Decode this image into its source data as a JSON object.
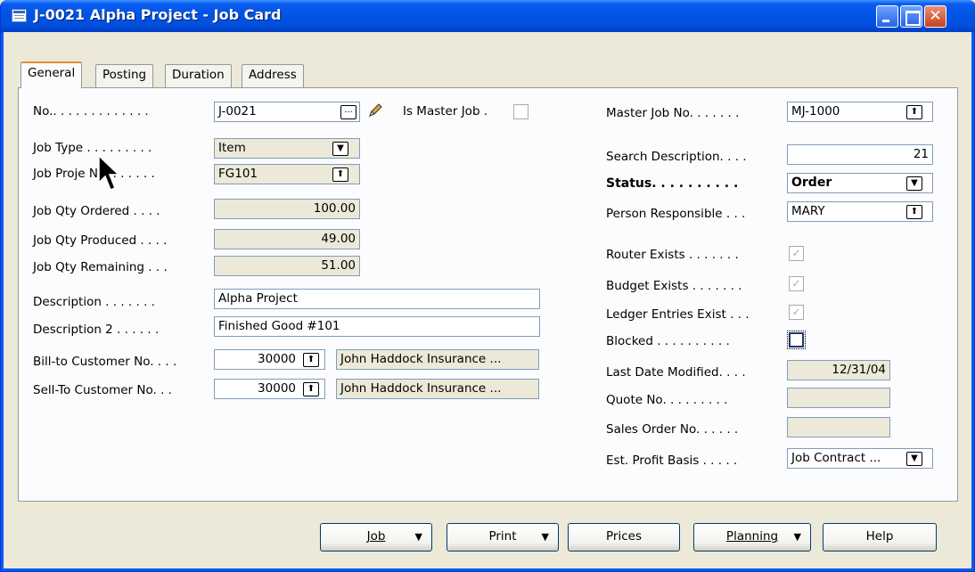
{
  "window": {
    "title": "J-0021 Alpha Project - Job Card"
  },
  "tabs": [
    "General",
    "Posting",
    "Duration",
    "Address"
  ],
  "left": {
    "no_label": "No.. . . . . . . . . . . . .",
    "no_value": "J-0021",
    "is_master_label": "Is Master Job .",
    "job_type_label": "Job Type . . . . . . . . .",
    "job_type_value": "Item",
    "job_project_label": "Job Proje   No.  . . . . . .",
    "job_project_value": "FG101",
    "qty_ordered_label": "Job Qty Ordered . . . .",
    "qty_ordered_value": "100.00",
    "qty_produced_label": "Job Qty Produced . . . .",
    "qty_produced_value": "49.00",
    "qty_remaining_label": "Job Qty Remaining . . .",
    "qty_remaining_value": "51.00",
    "description_label": "Description . . . . . . .",
    "description_value": "Alpha Project",
    "description2_label": "Description 2 . . . . . .",
    "description2_value": "Finished Good #101",
    "bill_to_label": "Bill-to Customer No. . . .",
    "bill_to_value": "30000",
    "bill_to_name": "John Haddock Insurance ...",
    "sell_to_label": "Sell-To Customer No. . .",
    "sell_to_value": "30000",
    "sell_to_name": "John Haddock Insurance ..."
  },
  "right": {
    "master_job_label": "Master Job No. . . . . . .",
    "master_job_value": "MJ-1000",
    "search_desc_label": "Search Description. . . .",
    "search_desc_value": "21",
    "status_label": "Status. . . . . . . . . .",
    "status_value": "Order",
    "person_label": "Person Responsible . . .",
    "person_value": "MARY",
    "router_label": "Router Exists . . . . . . .",
    "budget_label": "Budget Exists . . . . . . .",
    "ledger_label": "Ledger Entries Exist . . .",
    "blocked_label": "Blocked . . . . . . . . . .",
    "last_modified_label": "Last Date Modified. . . .",
    "last_modified_value": "12/31/04",
    "quote_label": "Quote No. . . . . . . . .",
    "quote_value": "",
    "sales_order_label": "Sales Order No. . . . . .",
    "sales_order_value": "",
    "profit_basis_label": "Est. Profit Basis . . . . .",
    "profit_basis_value": "Job Contract ..."
  },
  "buttons": {
    "job": "Job",
    "print": "Print",
    "prices": "Prices",
    "planning": "Planning",
    "help": "Help"
  }
}
